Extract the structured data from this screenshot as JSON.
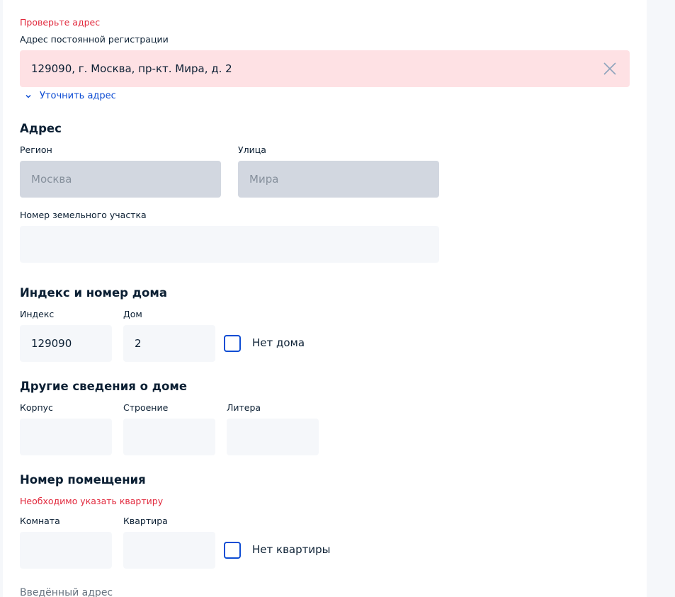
{
  "registration": {
    "error": "Проверьте адрес",
    "label": "Адрес постоянной регистрации",
    "value": "129090, г. Москва, пр-кт. Мира, д. 2",
    "refine_link": "Уточнить адрес"
  },
  "address": {
    "heading": "Адрес",
    "region_label": "Регион",
    "region_value": "Москва",
    "street_label": "Улица",
    "street_value": "Мира",
    "plot_label": "Номер земельного участка",
    "plot_value": ""
  },
  "index_house": {
    "heading": "Индекс и номер дома",
    "index_label": "Индекс",
    "index_value": "129090",
    "house_label": "Дом",
    "house_value": "2",
    "no_house_label": "Нет дома"
  },
  "other_house": {
    "heading": "Другие сведения о доме",
    "korpus_label": "Корпус",
    "stroenie_label": "Строение",
    "litera_label": "Литера"
  },
  "premises": {
    "heading": "Номер помещения",
    "error": "Необходимо указать квартиру",
    "room_label": "Комната",
    "apartment_label": "Квартира",
    "no_apartment_label": "Нет квартиры"
  },
  "entered_address": {
    "label": "Введённый адрес"
  },
  "colors": {
    "error": "#e1283c",
    "link": "#0d4cd3",
    "error_bg": "#fee1e4",
    "disabled_bg": "#d2d7e0"
  },
  "icons": {
    "clear": "close-icon",
    "refine": "chevron-down-icon",
    "checkbox": "checkbox-unchecked"
  }
}
